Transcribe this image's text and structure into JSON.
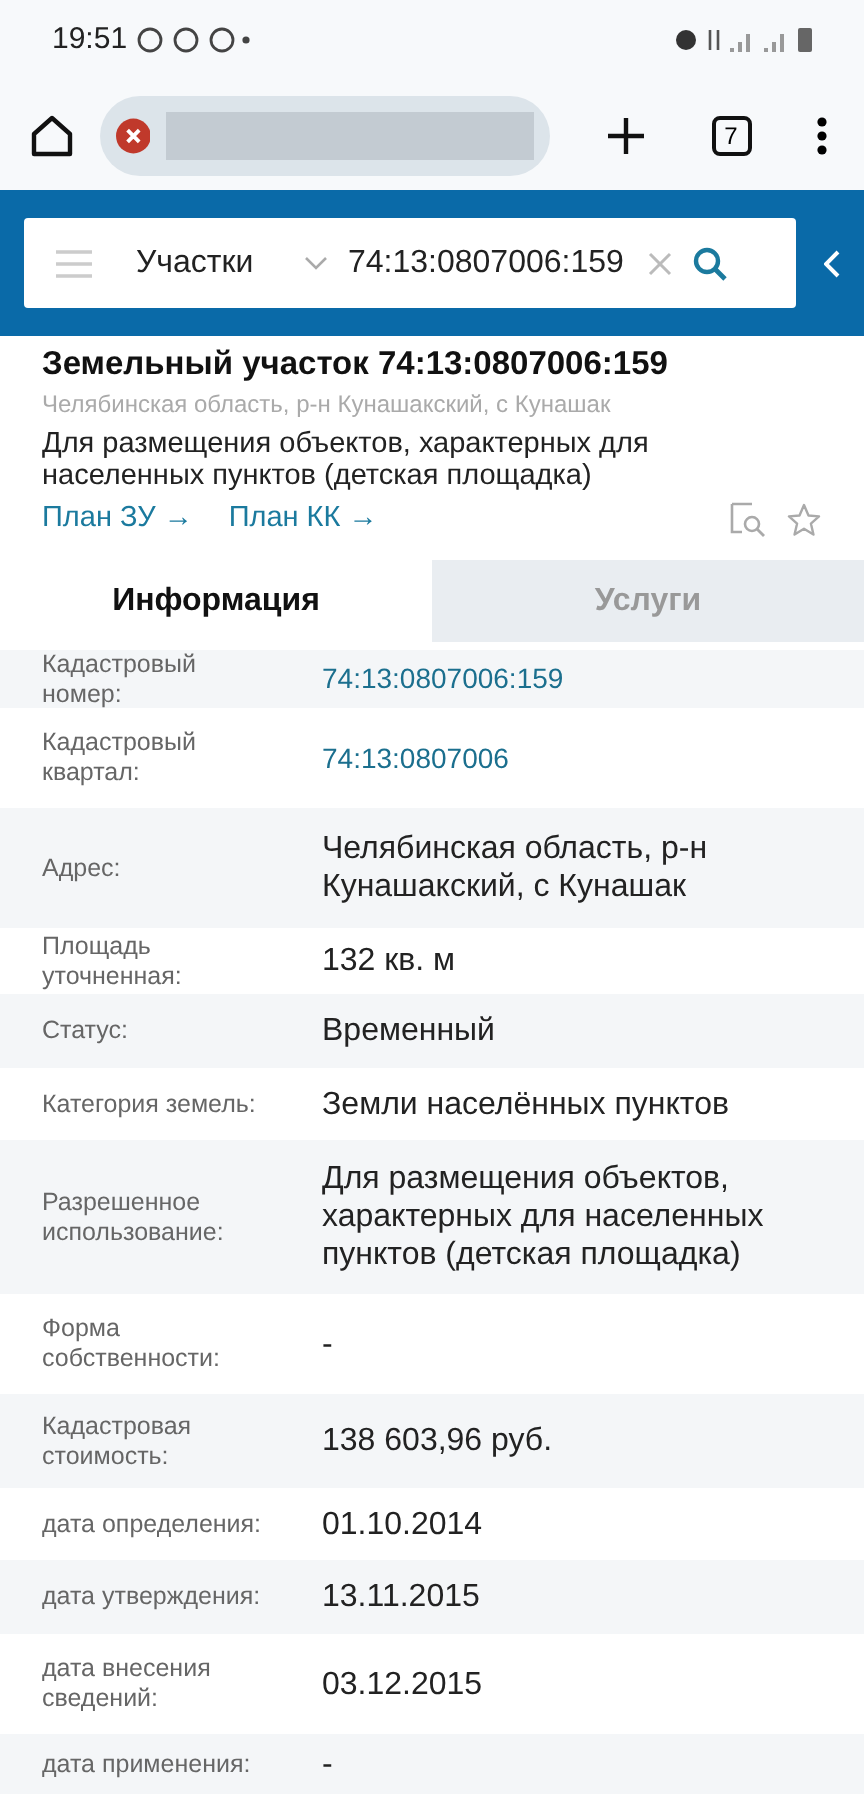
{
  "status_bar": {
    "time": "19:51"
  },
  "browser": {
    "tab_count": "7"
  },
  "search": {
    "category": "Участки",
    "value": "74:13:0807006:159"
  },
  "parcel": {
    "title": "Земельный участок 74:13:0807006:159",
    "address": "Челябинская область, р-н Кунашакский, с Кунашак",
    "purpose": "Для размещения объектов, характерных для населенных пунктов (детская площадка)",
    "links": [
      "План ЗУ →",
      "План КК →"
    ]
  },
  "tabs": [
    {
      "label": "Информация",
      "selected": true
    },
    {
      "label": "Услуги",
      "selected": false
    }
  ],
  "rows": [
    {
      "label": "Кадастровый номер:",
      "value": "74:13:0807006:159",
      "kind": "link"
    },
    {
      "label": "Кадастровый квартал:",
      "value": "74:13:0807006",
      "kind": "link"
    },
    {
      "label": "Адрес:",
      "value": "Челябинская область, р-н Кунашакский, с Кунашак",
      "kind": "text"
    },
    {
      "label": "Площадь уточненная:",
      "value": "132 кв. м",
      "kind": "text"
    },
    {
      "label": "Статус:",
      "value": "Временный",
      "kind": "text"
    },
    {
      "label": "Категория земель:",
      "value": "Земли населённых пунктов",
      "kind": "text"
    },
    {
      "label": "Разрешенное использование:",
      "value": "Для размещения объектов, характерных для населенных пунктов (детская площадка)",
      "kind": "text"
    },
    {
      "label": "Форма собственности:",
      "value": "-",
      "kind": "text"
    },
    {
      "label": "Кадастровая стоимость:",
      "value": "138 603,96 руб.",
      "kind": "text"
    },
    {
      "label": "дата определения:",
      "value": "01.10.2014",
      "kind": "text"
    },
    {
      "label": "дата утверждения:",
      "value": "13.11.2015",
      "kind": "text"
    },
    {
      "label": "дата внесения сведений:",
      "value": "03.12.2015",
      "kind": "text"
    },
    {
      "label": "дата применения:",
      "value": "-",
      "kind": "text"
    }
  ]
}
